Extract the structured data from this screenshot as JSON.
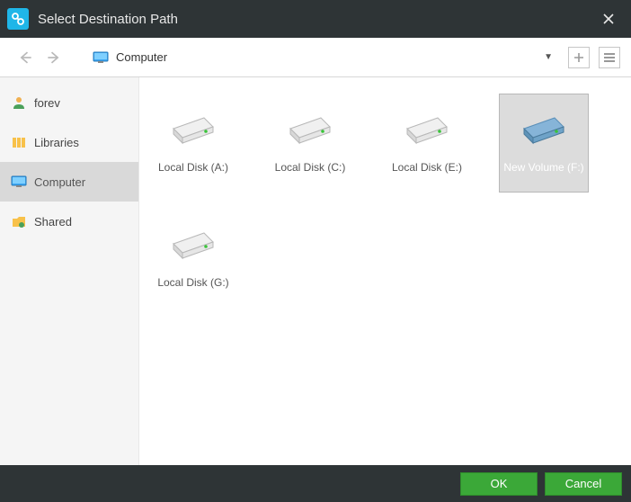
{
  "window": {
    "title": "Select Destination Path"
  },
  "toolbar": {
    "path": "Computer"
  },
  "sidebar": {
    "items": [
      {
        "label": "forev",
        "icon": "user"
      },
      {
        "label": "Libraries",
        "icon": "library"
      },
      {
        "label": "Computer",
        "icon": "computer",
        "selected": true
      },
      {
        "label": "Shared",
        "icon": "shared"
      }
    ]
  },
  "drives": [
    {
      "label": "Local Disk (A:)",
      "color": "light"
    },
    {
      "label": "Local Disk (C:)",
      "color": "light"
    },
    {
      "label": "Local Disk (E:)",
      "color": "light"
    },
    {
      "label": "New Volume (F:)",
      "color": "blue",
      "selected": true
    },
    {
      "label": "Local Disk (G:)",
      "color": "light"
    }
  ],
  "footer": {
    "ok": "OK",
    "cancel": "Cancel"
  }
}
